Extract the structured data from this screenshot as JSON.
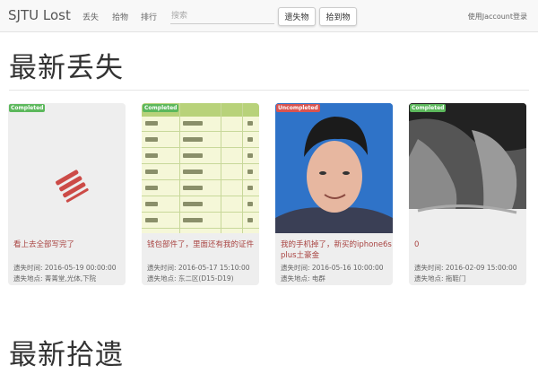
{
  "navbar": {
    "brand": "SJTU Lost",
    "links": [
      "丢失",
      "拾物",
      "排行"
    ],
    "search_placeholder": "搜索",
    "buttons": [
      "遗失物",
      "拾到物"
    ],
    "login": "使用Jaccount登录"
  },
  "sections": {
    "lost_title": "最新丢失",
    "found_title": "最新拾遗"
  },
  "cards": [
    {
      "status": "Completed",
      "title": "看上去全部写完了",
      "time": "遗失时间: 2016-05-19 00:00:00",
      "place": "遗失地点: 菁菁堂,光体,下院"
    },
    {
      "status": "Completed",
      "title": "钱包部件了，里面还有我的证件",
      "time": "遗失时间: 2016-05-17 15:10:00",
      "place": "遗失地点: 东二区(D15-D19)"
    },
    {
      "status": "Uncompleted",
      "title": "我的手机掉了，新买的iphone6s plus土豪金",
      "time": "遗失时间: 2016-05-16 10:00:00",
      "place": "遗失地点: 电群"
    },
    {
      "status": "Completed",
      "title": "0",
      "time": "遗失时间: 2016-02-09 15:00:00",
      "place": "遗失地点: 拖鞋门"
    }
  ],
  "colors": {
    "completed": "#5cb85c",
    "uncompleted": "#d9534f",
    "card_title": "#a94442"
  }
}
